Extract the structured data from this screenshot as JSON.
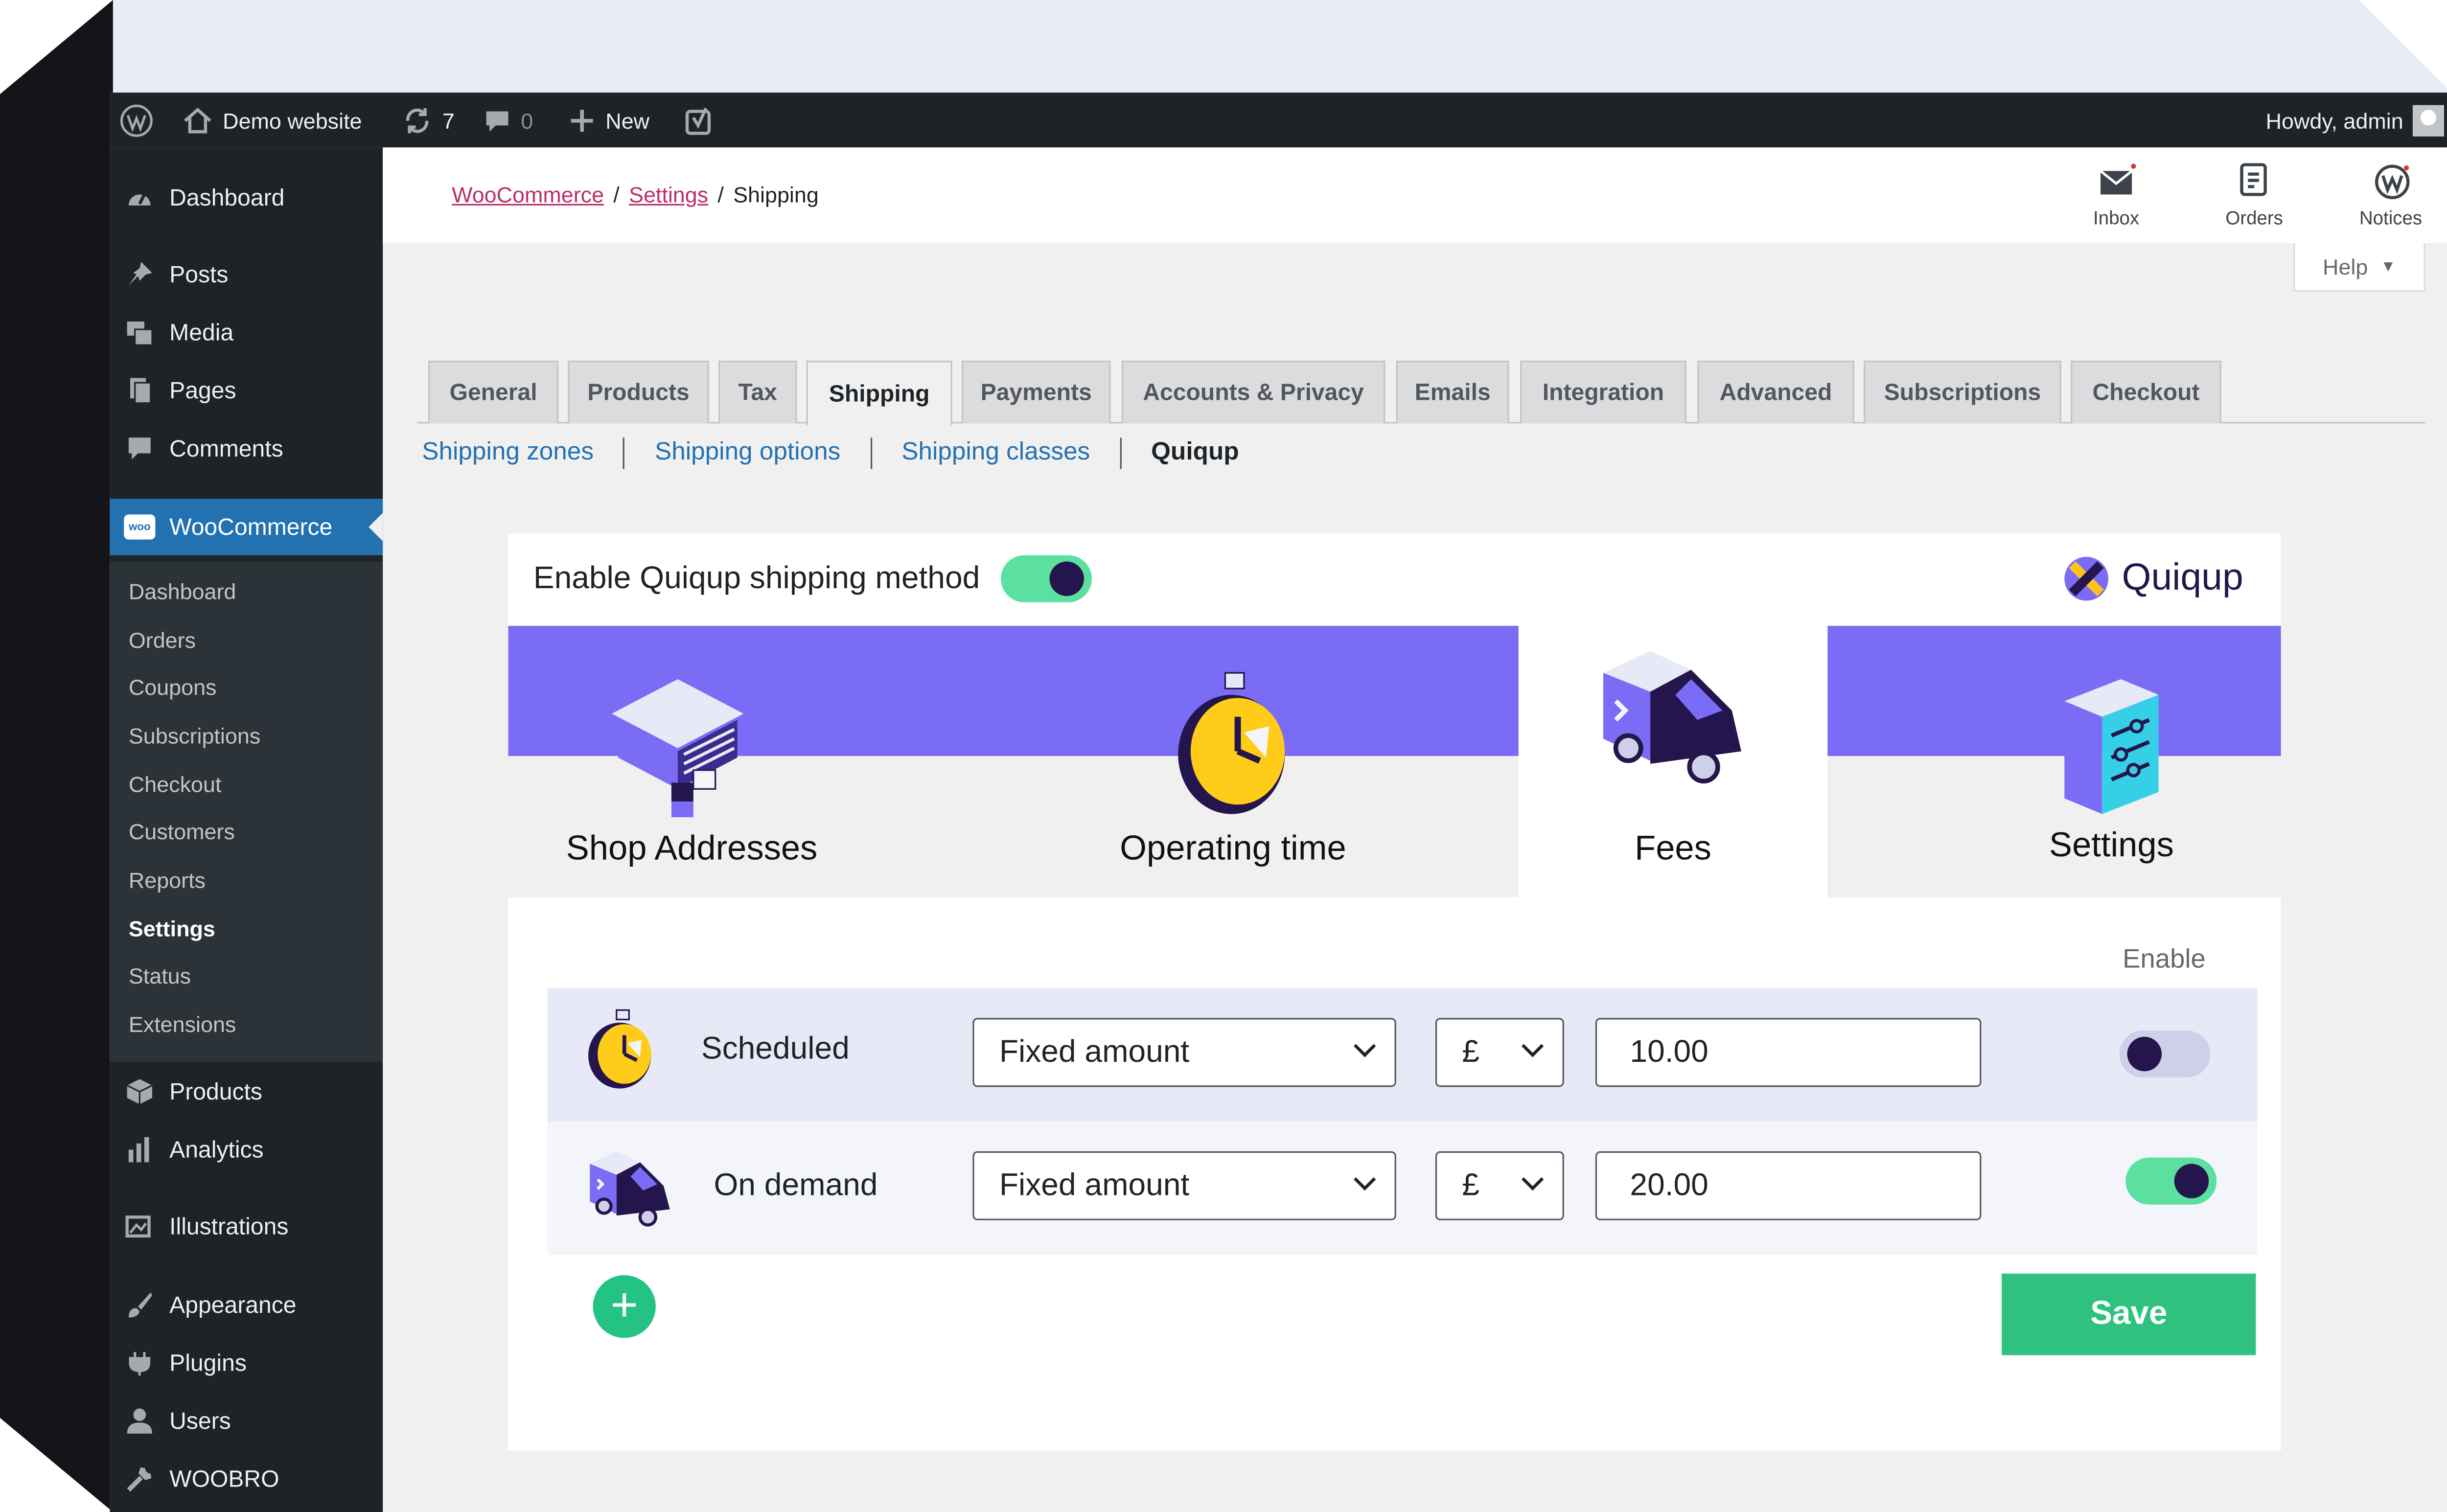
{
  "admin_bar": {
    "site_name": "Demo website",
    "updates_count": "7",
    "comments_count": "0",
    "new_label": "New",
    "greeting": "Howdy, admin"
  },
  "sidebar": {
    "items": [
      {
        "label": "Dashboard",
        "icon": "dashboard-icon"
      },
      {
        "label": "Posts",
        "icon": "pushpin-icon"
      },
      {
        "label": "Media",
        "icon": "media-icon"
      },
      {
        "label": "Pages",
        "icon": "pages-icon"
      },
      {
        "label": "Comments",
        "icon": "comment-icon"
      },
      {
        "label": "WooCommerce",
        "icon": "woo-icon"
      },
      {
        "label": "Products",
        "icon": "box-icon"
      },
      {
        "label": "Analytics",
        "icon": "bar-chart-icon"
      },
      {
        "label": "Illustrations",
        "icon": "images-icon"
      },
      {
        "label": "Appearance",
        "icon": "paintbrush-icon"
      },
      {
        "label": "Plugins",
        "icon": "plug-icon"
      },
      {
        "label": "Users",
        "icon": "user-icon"
      },
      {
        "label": "WOOBRO",
        "icon": "wrench-icon"
      }
    ],
    "woo_badge": "woo",
    "woo_submenu": [
      "Dashboard",
      "Orders",
      "Coupons",
      "Subscriptions",
      "Checkout",
      "Customers",
      "Reports",
      "Settings",
      "Status",
      "Extensions"
    ]
  },
  "header": {
    "breadcrumb": [
      "WooCommerce",
      "Settings",
      "Shipping"
    ],
    "buttons": [
      "Inbox",
      "Orders",
      "Notices"
    ],
    "help_label": "Help"
  },
  "tabs": [
    "General",
    "Products",
    "Tax",
    "Shipping",
    "Payments",
    "Accounts & Privacy",
    "Emails",
    "Integration",
    "Advanced",
    "Subscriptions",
    "Checkout"
  ],
  "active_tab": "Shipping",
  "subtabs": [
    "Shipping zones",
    "Shipping options",
    "Shipping classes",
    "Quiqup"
  ],
  "quiqup": {
    "enable_label": "Enable Quiqup shipping method",
    "enabled": true,
    "brand": "Quiqup",
    "steps": [
      "Shop Addresses",
      "Operating time",
      "Fees",
      "Settings"
    ],
    "active_step": "Fees",
    "enable_column_label": "Enable",
    "fees": [
      {
        "name": "Scheduled",
        "type": "Fixed amount",
        "currency": "£",
        "amount": "10.00",
        "enabled": false
      },
      {
        "name": "On demand",
        "type": "Fixed amount",
        "currency": "£",
        "amount": "20.00",
        "enabled": true
      }
    ],
    "add_label": "+",
    "save_label": "Save"
  },
  "colors": {
    "admin_bar": "#1d2327",
    "accent_blue": "#2271b1",
    "woo_pink": "#bb2e66",
    "quiqup_purple": "#7b6cf6",
    "toggle_on": "#5ce0a0",
    "save_green": "#2ec27e"
  }
}
